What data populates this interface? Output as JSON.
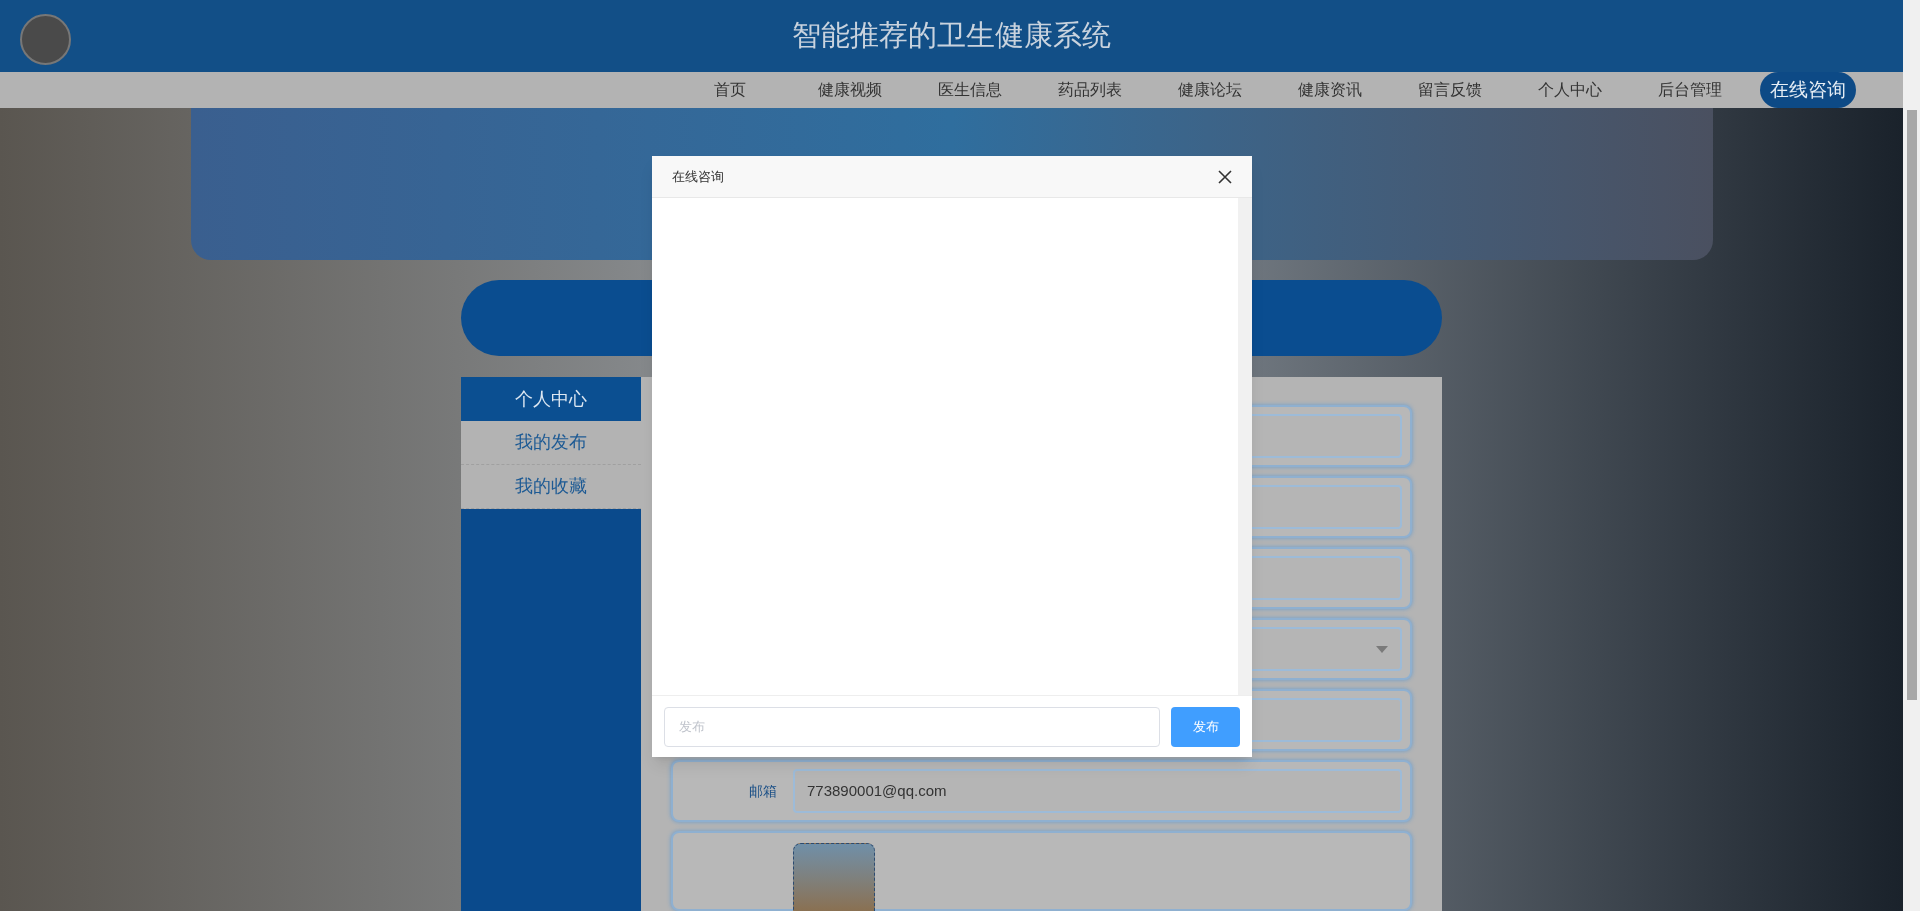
{
  "header": {
    "title": "智能推荐的卫生健康系统"
  },
  "nav": {
    "items": [
      {
        "label": "首页"
      },
      {
        "label": "健康视频"
      },
      {
        "label": "医生信息"
      },
      {
        "label": "药品列表"
      },
      {
        "label": "健康论坛"
      },
      {
        "label": "健康资讯"
      },
      {
        "label": "留言反馈"
      },
      {
        "label": "个人中心"
      },
      {
        "label": "后台管理"
      }
    ],
    "action": "在线咨询"
  },
  "sidebar": {
    "items": [
      {
        "label": "个人中心",
        "selected": true
      },
      {
        "label": "我的发布",
        "selected": false
      },
      {
        "label": "我的收藏",
        "selected": false
      }
    ]
  },
  "form": {
    "rows": [
      {
        "kind": "input"
      },
      {
        "kind": "input"
      },
      {
        "kind": "input"
      },
      {
        "kind": "select"
      },
      {
        "kind": "input"
      },
      {
        "kind": "input",
        "label": "邮箱",
        "value": "773890001@qq.com"
      },
      {
        "kind": "avatar"
      }
    ]
  },
  "dialog": {
    "title": "在线咨询",
    "input": {
      "placeholder": "发布"
    },
    "submit": "发布"
  }
}
